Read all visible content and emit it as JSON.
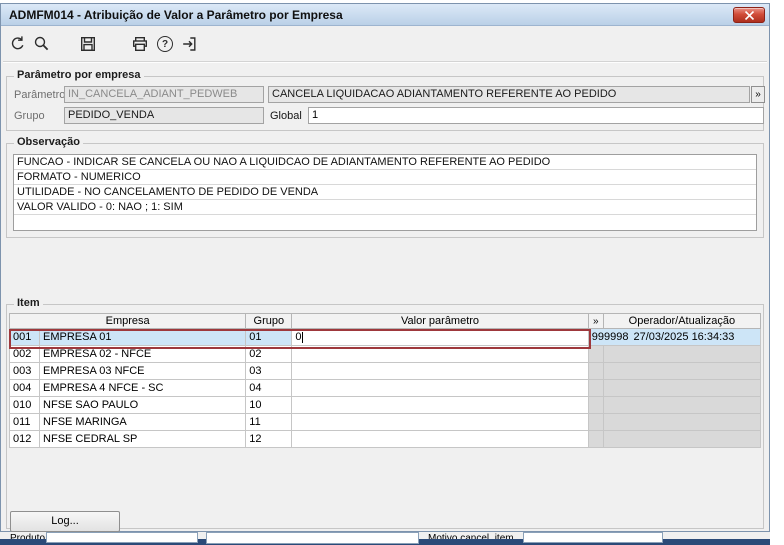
{
  "window": {
    "title": "ADMFM014 - Atribuição de Valor a Parâmetro por Empresa"
  },
  "toolbar": {
    "buttons": [
      "undo",
      "search",
      "save",
      "print",
      "help",
      "exit"
    ],
    "help_glyph": "?"
  },
  "param_group": {
    "title": "Parâmetro por empresa",
    "param_label": "Parâmetro",
    "param_value": "IN_CANCELA_ADIANT_PEDWEB",
    "param_desc": "CANCELA LIQUIDACAO ADIANTAMENTO REFERENTE AO PEDIDO",
    "expand_button": "»",
    "grupo_label": "Grupo",
    "grupo_value": "PEDIDO_VENDA",
    "global_label": "Global",
    "global_value": "1"
  },
  "obs_group": {
    "title": "Observação",
    "lines": [
      "FUNCAO - INDICAR SE CANCELA OU NAO A LIQUIDCAO DE ADIANTAMENTO REFERENTE AO PEDIDO",
      "FORMATO - NUMERICO",
      "UTILIDADE - NO CANCELAMENTO DE PEDIDO DE VENDA",
      "VALOR VALIDO - 0: NAO ; 1: SIM"
    ]
  },
  "item_group": {
    "title": "Item",
    "columns": [
      "Empresa",
      "Grupo",
      "Valor parâmetro",
      "»",
      "Operador/Atualização"
    ],
    "rows": [
      {
        "num": "001",
        "empresa": "EMPRESA 01",
        "grupo": "01",
        "valor": "0",
        "operador": "999998",
        "atualizacao": "27/03/2025 16:34:33"
      },
      {
        "num": "002",
        "empresa": "EMPRESA 02 - NFCE",
        "grupo": "02",
        "valor": ""
      },
      {
        "num": "003",
        "empresa": "EMPRESA 03 NFCE",
        "grupo": "03",
        "valor": ""
      },
      {
        "num": "004",
        "empresa": "EMPRESA 4 NFCE - SC",
        "grupo": "04",
        "valor": ""
      },
      {
        "num": "010",
        "empresa": "NFSE SAO PAULO",
        "grupo": "10",
        "valor": ""
      },
      {
        "num": "011",
        "empresa": "NFSE MARINGA",
        "grupo": "11",
        "valor": ""
      },
      {
        "num": "012",
        "empresa": "NFSE CEDRAL SP",
        "grupo": "12",
        "valor": ""
      }
    ]
  },
  "log_button": {
    "label": "Log..."
  },
  "background_window": {
    "produto_label": "Produto",
    "motivo_label": "Motivo cancel. item"
  }
}
